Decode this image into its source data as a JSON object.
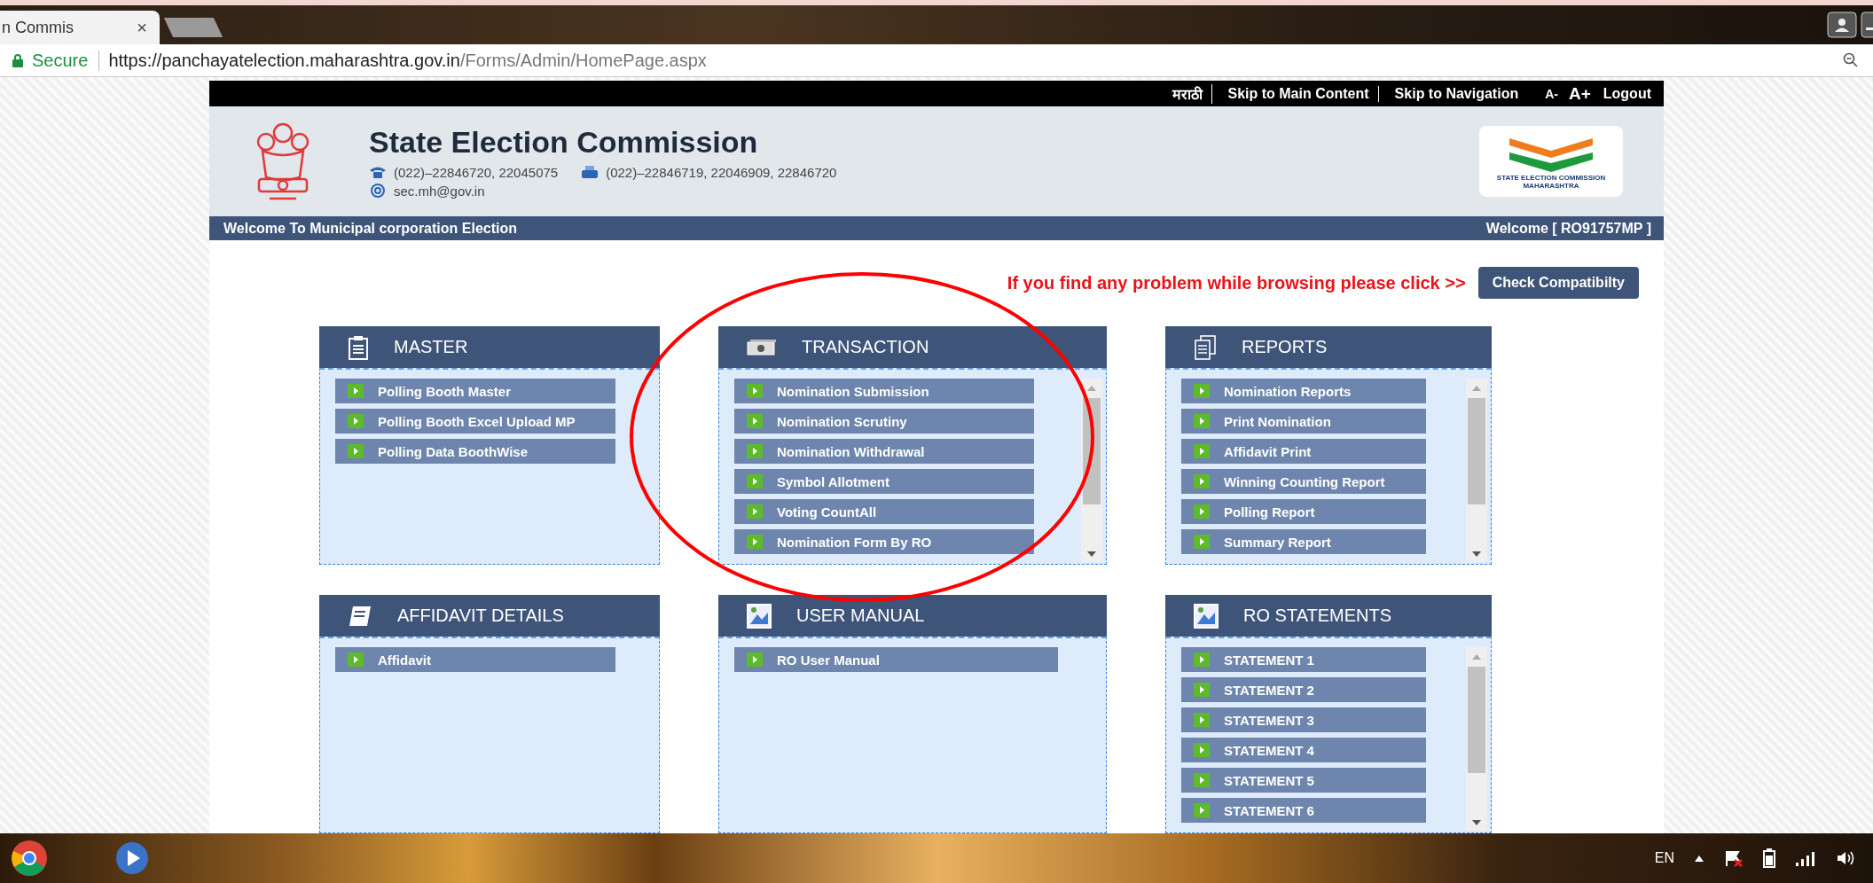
{
  "browser": {
    "tab_title": "n Commis",
    "tab_close": "×",
    "secure_label": "Secure",
    "url_host": "https://panchayatelection.maharashtra.gov.in",
    "url_path": "/Forms/Admin/HomePage.aspx"
  },
  "top_links": [
    {
      "label": "मराठी",
      "kind": "link"
    },
    {
      "label": "Skip to Main Content",
      "kind": "link"
    },
    {
      "label": "Skip to Navigation",
      "kind": "link"
    },
    {
      "label": "A-",
      "kind": "small"
    },
    {
      "label": "A+",
      "kind": "large"
    },
    {
      "label": "Logout",
      "kind": "link"
    }
  ],
  "header": {
    "title": "State Election Commission",
    "phone": "(022)–22846720, 22045075",
    "fax": "(022)–22846719, 22046909, 22846720",
    "email": "sec.mh@gov.in",
    "logo_line_1": "STATE ELECTION COMMISSION",
    "logo_line_2": "MAHARASHTRA"
  },
  "welcome_bar": {
    "left": "Welcome To Municipal corporation Election",
    "right": "Welcome [ RO91757MP ]"
  },
  "compatibility": {
    "message": "If you find any problem while browsing please click >>",
    "button": "Check Compatibilty"
  },
  "panels": [
    {
      "title": "MASTER",
      "scrollable": false,
      "items": [
        "Polling Booth Master",
        "Polling Booth Excel Upload MP",
        "Polling Data BoothWise"
      ]
    },
    {
      "title": "TRANSACTION",
      "scrollable": true,
      "items": [
        "Nomination Submission",
        "Nomination Scrutiny",
        "Nomination Withdrawal",
        "Symbol Allotment",
        "Voting CountAll",
        "Nomination Form By RO"
      ]
    },
    {
      "title": "REPORTS",
      "scrollable": true,
      "items": [
        "Nomination Reports",
        "Print Nomination",
        "Affidavit Print",
        "Winning Counting Report",
        "Polling Report",
        "Summary Report"
      ]
    },
    {
      "title": "AFFIDAVIT DETAILS",
      "scrollable": false,
      "items": [
        "Affidavit"
      ]
    },
    {
      "title": "USER MANUAL",
      "scrollable": false,
      "items": [
        "RO User Manual"
      ]
    },
    {
      "title": "RO STATEMENTS",
      "scrollable": true,
      "items": [
        "STATEMENT 1",
        "STATEMENT 2",
        "STATEMENT 3",
        "STATEMENT 4",
        "STATEMENT 5",
        "STATEMENT 6"
      ]
    }
  ],
  "taskbar": {
    "language": "EN"
  }
}
